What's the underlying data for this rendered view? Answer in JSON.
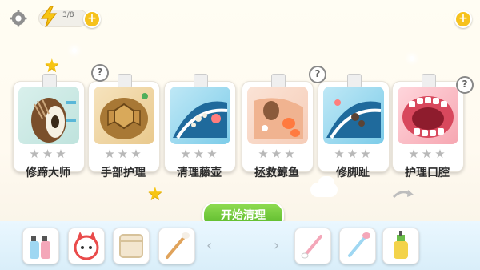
{
  "topbar": {
    "energy_text": "3/8",
    "energy_plus": "+",
    "right_plus": "+"
  },
  "levels": [
    {
      "label": "修蹄大师",
      "stars": "★★★",
      "locked": false
    },
    {
      "label": "手部护理",
      "stars": "★★★",
      "locked": true
    },
    {
      "label": "清理藤壶",
      "stars": "★★★",
      "locked": false
    },
    {
      "label": "拯救鲸鱼",
      "stars": "★★★",
      "locked": true
    },
    {
      "label": "修脚趾",
      "stars": "★★★",
      "locked": false
    },
    {
      "label": "护理口腔",
      "stars": "★★★",
      "locked": true
    }
  ],
  "question_mark": "?",
  "start_button": "开始清理",
  "nav": {
    "prev": "‹",
    "next": "›"
  },
  "tools": [
    "spray-bottles-icon",
    "cat-mascot-icon",
    "towel-icon",
    "cotton-swab-icon",
    "cotton-swab-icon",
    "cotton-swab-icon",
    "lotion-bottle-icon"
  ],
  "colors": {
    "accent_green": "#56b627",
    "star_gold": "#f7c512",
    "plus_yellow": "#f6c21d"
  }
}
